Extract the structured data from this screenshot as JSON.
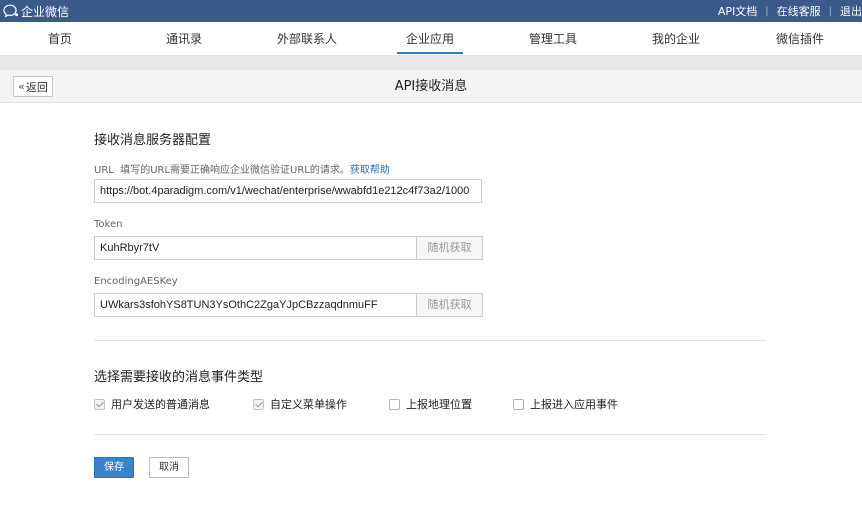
{
  "app": {
    "logo_text": "企业微信"
  },
  "top_links": {
    "api_docs": "API文档",
    "online_support": "在线客服",
    "logout": "退出",
    "separator": "|"
  },
  "nav": {
    "items": [
      {
        "label": "首页"
      },
      {
        "label": "通讯录"
      },
      {
        "label": "外部联系人"
      },
      {
        "label": "企业应用"
      },
      {
        "label": "管理工具"
      },
      {
        "label": "我的企业"
      },
      {
        "label": "微信插件"
      }
    ],
    "active": "企业应用"
  },
  "header": {
    "back_label": "返回",
    "back_icon": "«",
    "title": "API接收消息"
  },
  "server_config": {
    "section_title": "接收消息服务器配置",
    "url": {
      "label": "URL",
      "hint": "填写的URL需要正确响应企业微信验证URL的请求。",
      "help_link": "获取帮助",
      "value": "https://bot.4paradigm.com/v1/wechat/enterprise/wwabfd1e212c4f73a2/1000"
    },
    "token": {
      "label": "Token",
      "value": "KuhRbyr7tV",
      "random_button": "随机获取"
    },
    "aes_key": {
      "label": "EncodingAESKey",
      "value": "UWkars3sfohYS8TUN3YsOthC2ZgaYJpCBzzaqdnmuFF",
      "random_button": "随机获取"
    }
  },
  "events": {
    "section_title": "选择需要接收的消息事件类型",
    "options": [
      {
        "label": "用户发送的普通消息",
        "checked": true
      },
      {
        "label": "自定义菜单操作",
        "checked": true
      },
      {
        "label": "上报地理位置",
        "checked": false
      },
      {
        "label": "上报进入应用事件",
        "checked": false
      }
    ]
  },
  "actions": {
    "save": "保存",
    "cancel": "取消"
  },
  "colors": {
    "topbar": "#3a5a89",
    "accent": "#2e7bd0",
    "link": "#2e6bb3",
    "save_button": "#3b82cf"
  }
}
